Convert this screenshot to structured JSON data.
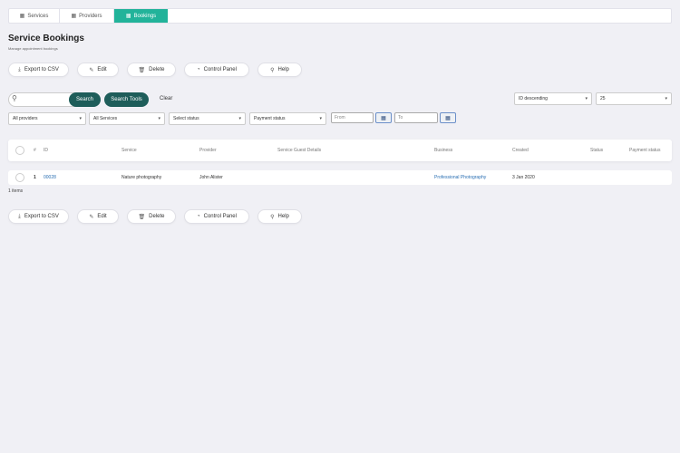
{
  "tabs": [
    {
      "label": "Services",
      "icon": "grid-icon",
      "active": false
    },
    {
      "label": "Providers",
      "icon": "grid-icon",
      "active": false
    },
    {
      "label": "Bookings",
      "icon": "grid-icon",
      "active": true
    }
  ],
  "header": {
    "title": "Service Bookings",
    "subtitle": "Manage appointment bookings"
  },
  "actions": {
    "export_label": "Export to CSV",
    "edit_label": "Edit",
    "delete_label": "Delete",
    "control_panel_label": "Control Panel",
    "help_label": "Help"
  },
  "search": {
    "placeholder": "",
    "button_label": "Search",
    "tools_label": "Search Tools",
    "clear_label": "Clear"
  },
  "sort": {
    "order_value": "ID descending",
    "page_size_value": "25"
  },
  "filters": {
    "providers_value": "All providers",
    "services_value": "All Services",
    "status_value": "Select status",
    "payment_value": "Payment status",
    "from_placeholder": "From",
    "to_placeholder": "To"
  },
  "table": {
    "columns": {
      "num": "#",
      "id": "ID",
      "service": "Service",
      "provider": "Provider",
      "guest": "Service Guest Details",
      "business": "Business",
      "created": "Created",
      "status": "Status",
      "payment": "Payment status"
    },
    "rows": [
      {
        "num": "1",
        "id": "00028",
        "service": "Nature photography",
        "provider": "John Alister",
        "guest": "",
        "business": "Professional Photography",
        "created": "3 Jan 2020",
        "status": "",
        "payment": ""
      }
    ],
    "count_text": "1 items"
  },
  "colors": {
    "accent": "#22b39a",
    "primary_button": "#1e5d5a",
    "link": "#2a6fb3",
    "background": "#f0f0f5"
  }
}
